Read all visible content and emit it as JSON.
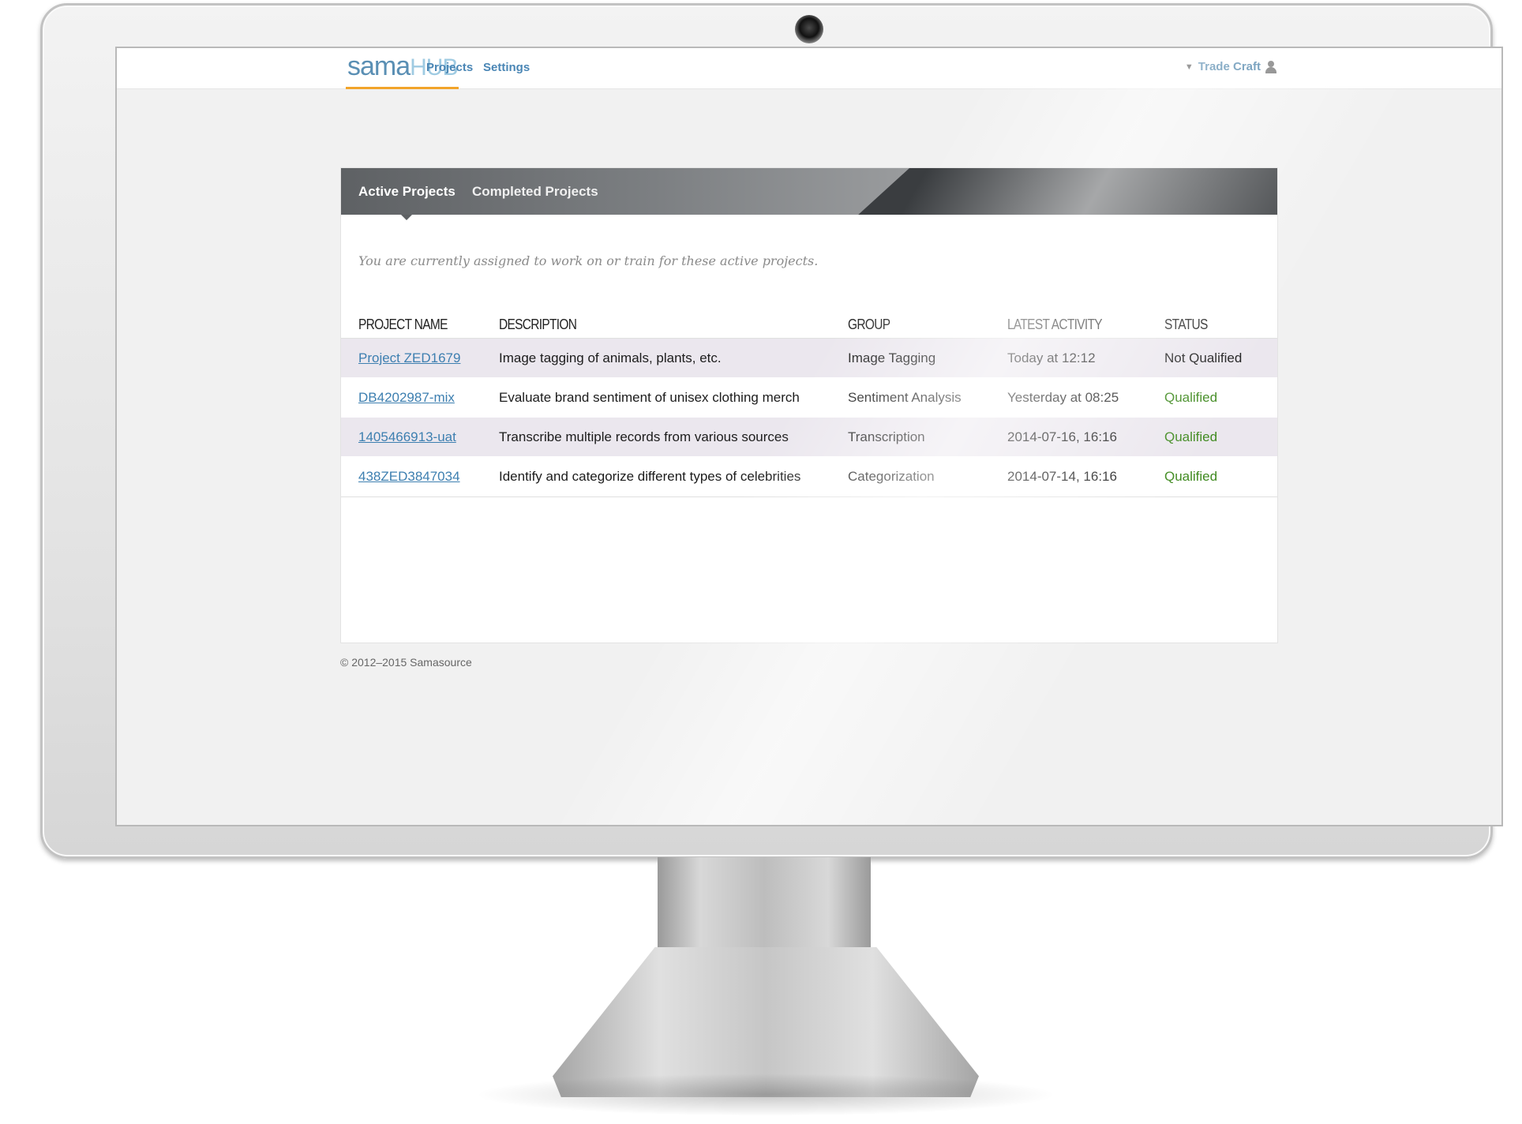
{
  "brand": {
    "logo_part1": "sama",
    "logo_part2": "HUB"
  },
  "nav": {
    "items": [
      {
        "label": "Projects"
      },
      {
        "label": "Settings"
      }
    ]
  },
  "user": {
    "name": "Trade Craft"
  },
  "tabs": [
    {
      "label": "Active Projects",
      "active": true
    },
    {
      "label": "Completed Projects",
      "active": false
    }
  ],
  "intro": "You are currently assigned to work on or train for these active projects.",
  "table": {
    "headers": [
      "PROJECT NAME",
      "DESCRIPTION",
      "GROUP",
      "LATEST ACTIVITY",
      "STATUS"
    ],
    "rows": [
      {
        "name": "Project ZED1679",
        "description": "Image tagging of animals, plants, etc.",
        "group": "Image Tagging",
        "activity": "Today at 12:12",
        "status": "Not Qualified"
      },
      {
        "name": "DB4202987-mix",
        "description": "Evaluate brand sentiment of unisex clothing merch",
        "group": "Sentiment Analysis",
        "activity": "Yesterday at 08:25",
        "status": "Qualified"
      },
      {
        "name": "1405466913-uat",
        "description": "Transcribe multiple records from various sources",
        "group": "Transcription",
        "activity": "2014-07-16, 16:16",
        "status": "Qualified"
      },
      {
        "name": "438ZED3847034",
        "description": "Identify and categorize different types of celebrities",
        "group": "Categorization",
        "activity": "2014-07-14, 16:16",
        "status": "Qualified"
      }
    ]
  },
  "footer": "© 2012–2015 Samasource",
  "colors": {
    "link": "#3d7fb0",
    "qualified": "#3f8a1f",
    "logo_underline": "#f2a42a",
    "tabbar_dark": "#3a3d40",
    "row_shade": "#ebe7ee"
  }
}
